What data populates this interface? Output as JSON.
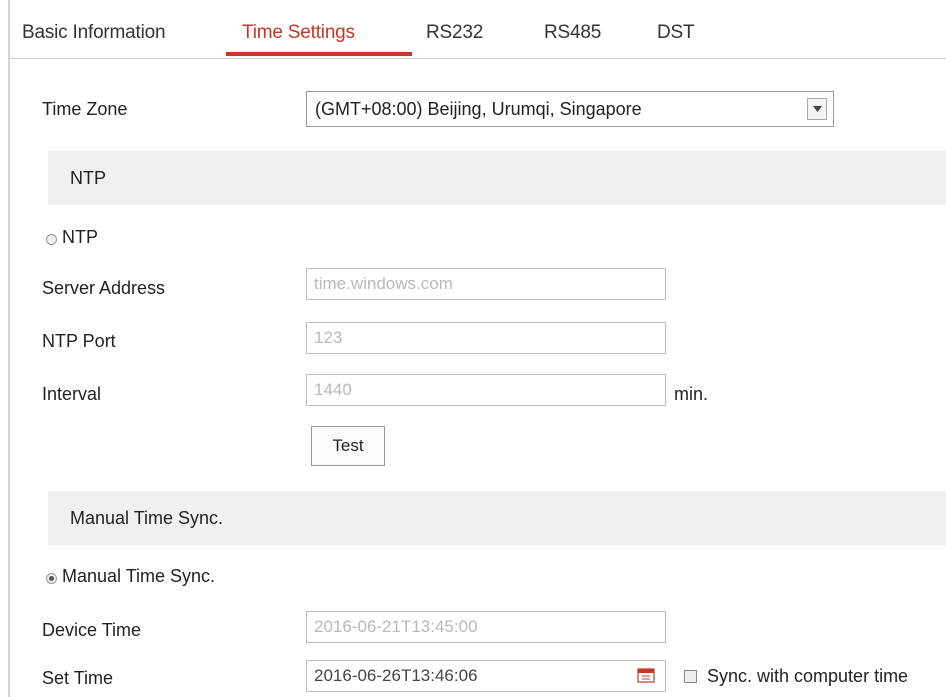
{
  "tabs": [
    {
      "label": "Basic Information",
      "active": false
    },
    {
      "label": "Time Settings",
      "active": true
    },
    {
      "label": "RS232",
      "active": false
    },
    {
      "label": "RS485",
      "active": false
    },
    {
      "label": "DST",
      "active": false
    }
  ],
  "time_zone": {
    "label": "Time Zone",
    "value": "(GMT+08:00) Beijing, Urumqi, Singapore"
  },
  "ntp_section": {
    "header": "NTP",
    "radio_label": "NTP",
    "selected": false,
    "server_address": {
      "label": "Server Address",
      "value": "time.windows.com"
    },
    "ntp_port": {
      "label": "NTP Port",
      "value": "123"
    },
    "interval": {
      "label": "Interval",
      "value": "1440",
      "unit": "min."
    },
    "test_button": "Test"
  },
  "manual_section": {
    "header": "Manual Time Sync.",
    "radio_label": "Manual Time Sync.",
    "selected": true,
    "device_time": {
      "label": "Device Time",
      "value": "2016-06-21T13:45:00"
    },
    "set_time": {
      "label": "Set Time",
      "value": "2016-06-26T13:46:06"
    },
    "sync_checkbox_label": "Sync. with computer time",
    "sync_checked": false
  },
  "colors": {
    "accent": "#c0392b",
    "section_bg": "#f0f0f0",
    "border": "#bcbcbc"
  }
}
